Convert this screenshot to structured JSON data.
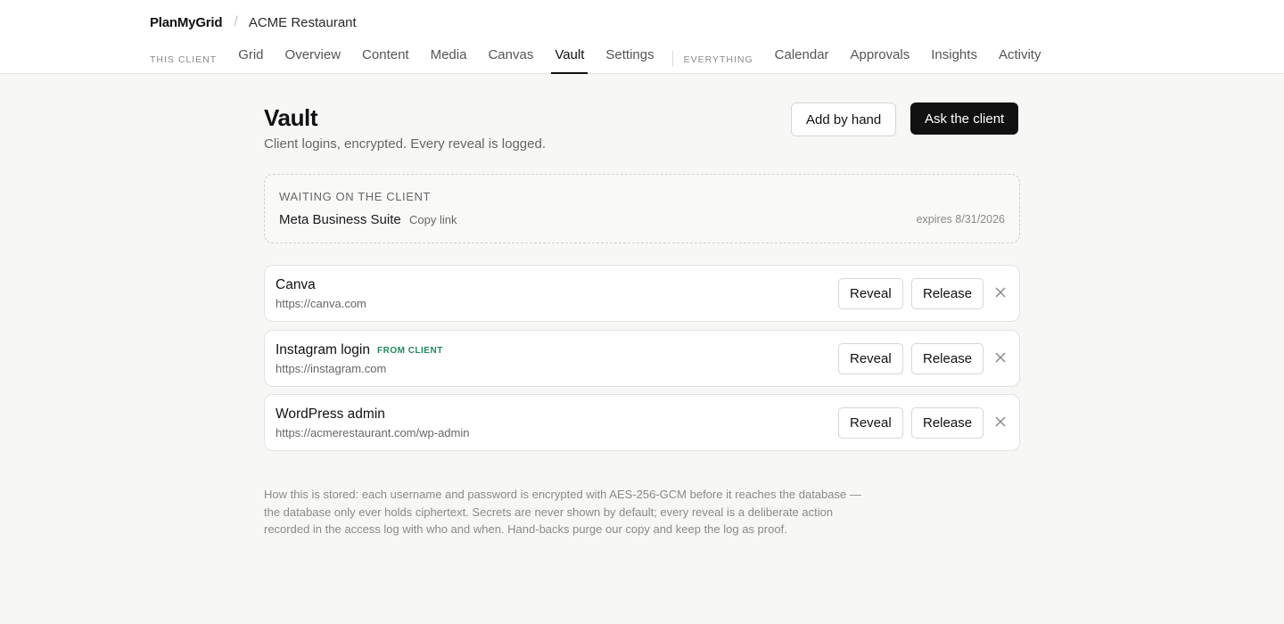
{
  "header": {
    "brand": "PlanMyGrid",
    "separator": "/",
    "client": "ACME Restaurant"
  },
  "nav": {
    "this_client_label": "THIS CLIENT",
    "this_client_items": [
      "Grid",
      "Overview",
      "Content",
      "Media",
      "Canvas",
      "Vault",
      "Settings"
    ],
    "everything_label": "EVERYTHING",
    "everything_items": [
      "Calendar",
      "Approvals",
      "Insights",
      "Activity"
    ],
    "active": "Vault"
  },
  "page": {
    "title": "Vault",
    "subtitle": "Client logins, encrypted. Every reveal is logged.",
    "add_button": "Add by hand",
    "ask_button": "Ask the client"
  },
  "pending": {
    "label": "WAITING ON THE CLIENT",
    "name": "Meta Business Suite",
    "copy_link": "Copy link",
    "expires": "expires 8/31/2026"
  },
  "credentials": [
    {
      "name": "Canva",
      "badge": "",
      "url": "https://canva.com",
      "reveal": "Reveal",
      "release": "Release"
    },
    {
      "name": "Instagram login",
      "badge": "FROM CLIENT",
      "url": "https://instagram.com",
      "reveal": "Reveal",
      "release": "Release"
    },
    {
      "name": "WordPress admin",
      "badge": "",
      "url": "https://acmerestaurant.com/wp-admin",
      "reveal": "Reveal",
      "release": "Release"
    }
  ],
  "footnote": "How this is stored: each username and password is encrypted with AES-256-GCM before it reaches the database — the database only ever holds ciphertext. Secrets are never shown by default; every reveal is a deliberate action recorded in the access log with who and when. Hand-backs purge our copy and keep the log as proof.",
  "colors": {
    "accent_dark": "#111111",
    "badge_green": "#1f8a5a",
    "background": "#f7f7f6"
  },
  "icons": {
    "remove": "close-icon"
  }
}
